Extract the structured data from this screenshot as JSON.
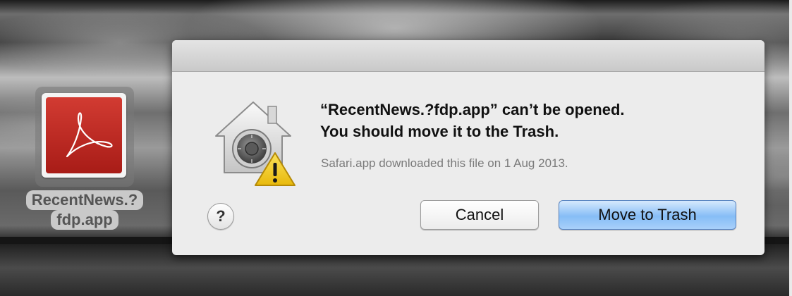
{
  "desktop": {
    "file_icon": {
      "icon": "adobe-acrobat-pdf-icon",
      "label_line1": "RecentNews.?",
      "label_line2": "fdp.app"
    }
  },
  "dialog": {
    "icon": "gatekeeper-house-lock-warning-icon",
    "headline_line1": "“RecentNews.?fdp.app” can’t be opened.",
    "headline_line2": "You should move it to the Trash.",
    "subtext": "Safari.app downloaded this file on 1 Aug 2013.",
    "help_label": "?",
    "cancel_label": "Cancel",
    "move_to_trash_label": "Move to Trash"
  },
  "colors": {
    "default_button": "#86bdf6",
    "warning": "#f4d11c",
    "acrobat_red": "#c42b25"
  }
}
